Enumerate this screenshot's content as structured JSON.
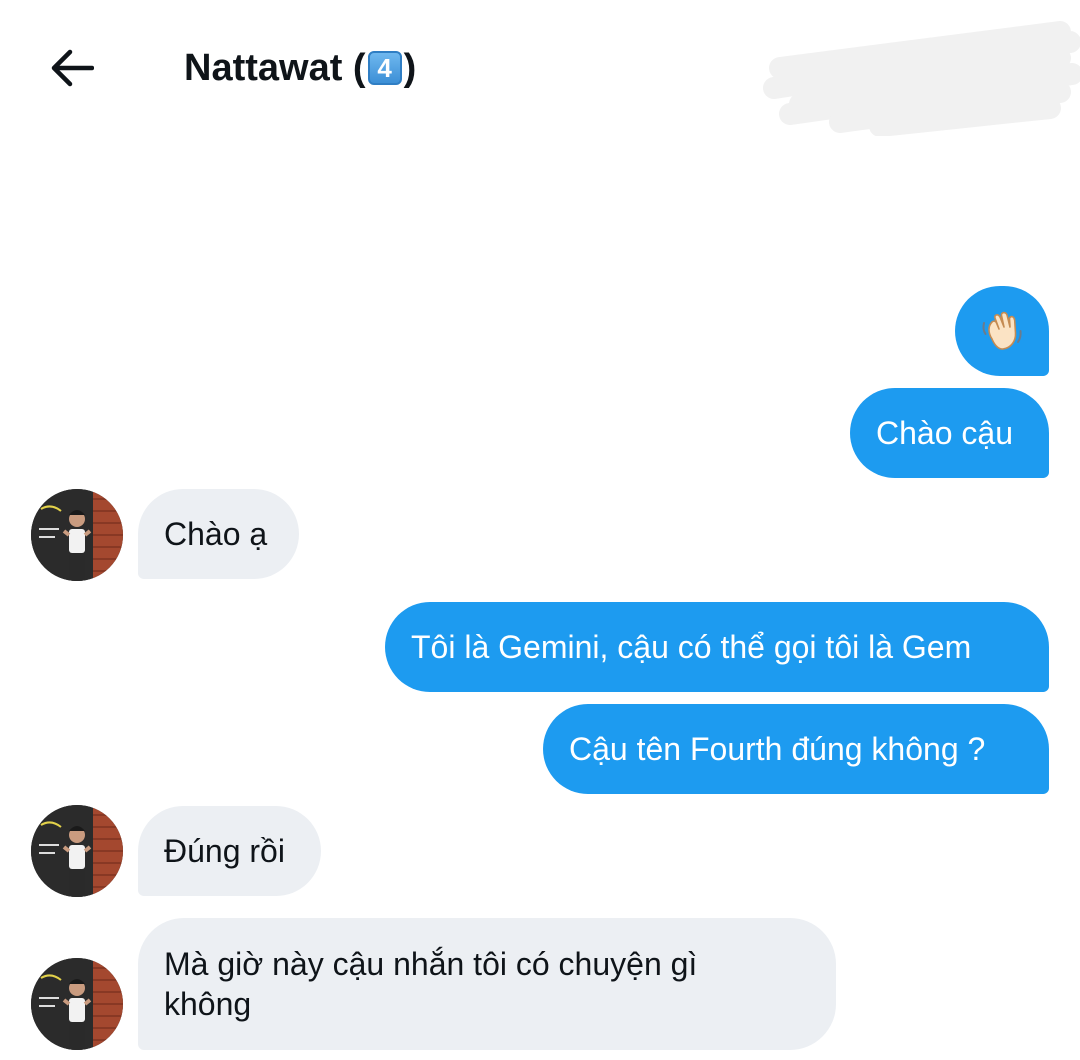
{
  "header": {
    "back_icon": "arrow-left-icon",
    "title_name": "Nattawat (",
    "title_keycap": "4",
    "title_close": ")"
  },
  "colors": {
    "outgoing_bubble": "#1d9bf0",
    "incoming_bubble": "#eceff3",
    "text_dark": "#0f1419"
  },
  "messages": [
    {
      "direction": "out",
      "type": "emoji",
      "icon": "waving-hand-icon"
    },
    {
      "direction": "out",
      "text": "Chào cậu"
    },
    {
      "direction": "in",
      "text": "Chào ạ"
    },
    {
      "direction": "out",
      "text": "Tôi là Gemini, cậu có thể gọi tôi là Gem"
    },
    {
      "direction": "out",
      "text": "Cậu tên Fourth đúng không ?"
    },
    {
      "direction": "in",
      "text": "Đúng rồi"
    },
    {
      "direction": "in",
      "text": "Mà giờ này cậu nhắn tôi có chuyện gì không"
    }
  ]
}
